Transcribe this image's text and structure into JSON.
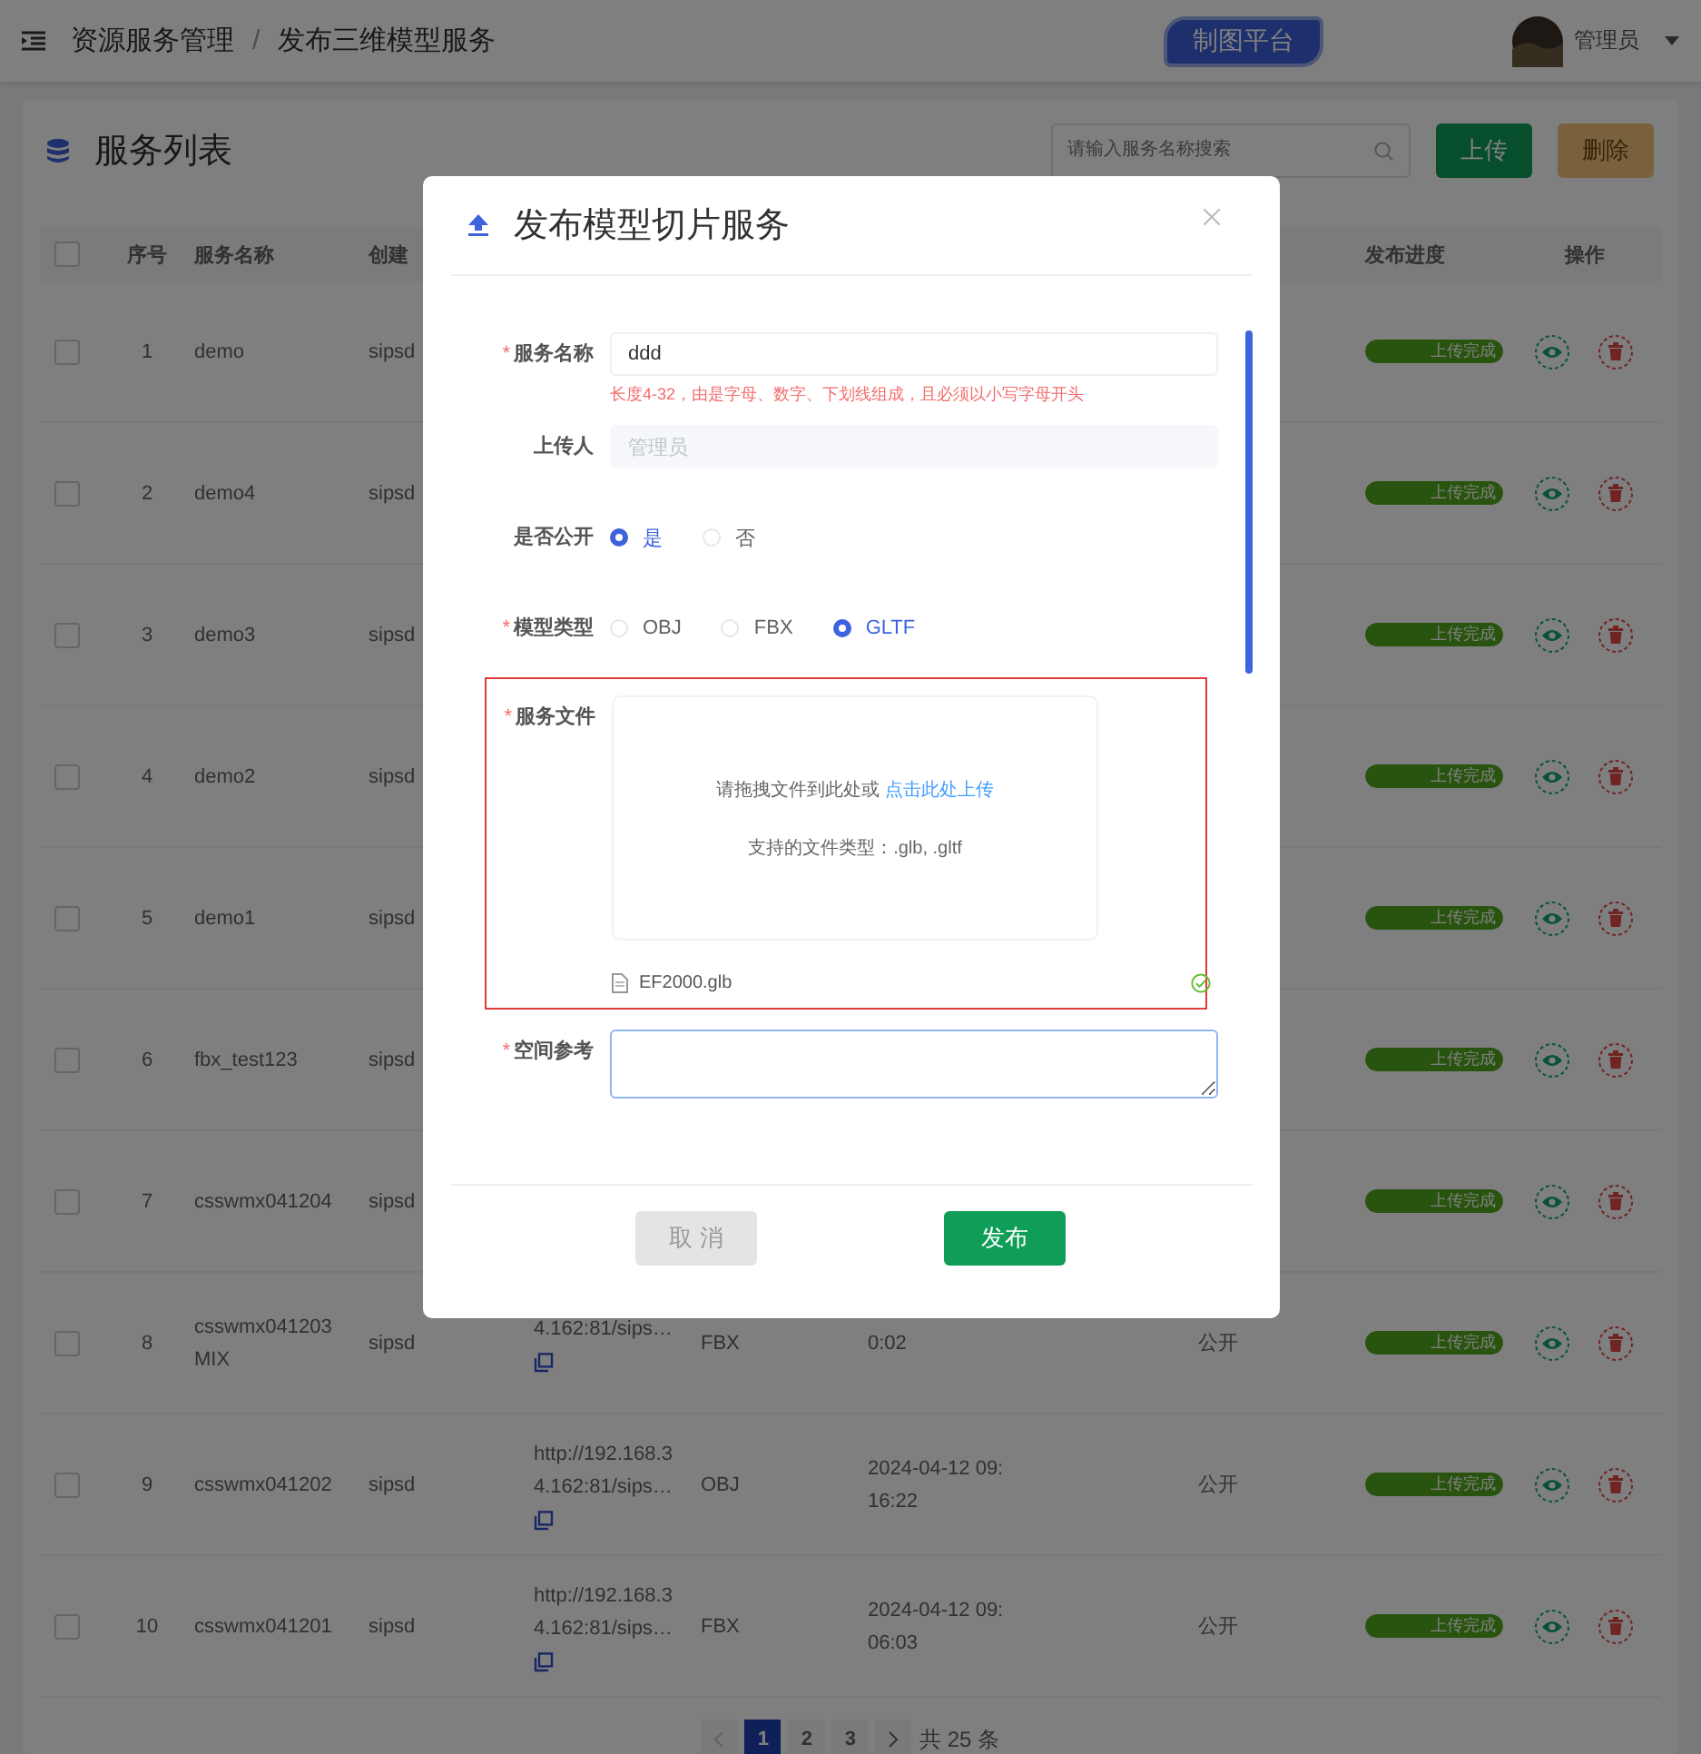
{
  "header": {
    "breadcrumb": [
      "资源服务管理",
      "发布三维模型服务"
    ],
    "separator": "/",
    "platform_badge": "制图平台",
    "user": "管理员"
  },
  "card": {
    "title": "服务列表",
    "search": {
      "placeholder": "请输入服务名称搜索"
    },
    "buttons": [
      {
        "label": "上传",
        "kind": "primary",
        "disabled": false
      },
      {
        "label": "删除",
        "kind": "danger",
        "disabled": true
      }
    ]
  },
  "table": {
    "all_checked": false,
    "columns": {
      "index": "序号",
      "name": "服务名称",
      "creator": "创建",
      "progress": "发布进度",
      "actions": "操作"
    },
    "rows": [
      {
        "checked": false,
        "index": "1",
        "name": "demo",
        "creator": "sipsd",
        "status": "上传完成",
        "level": 1
      },
      {
        "checked": false,
        "index": "2",
        "name": "demo4",
        "creator": "sipsd",
        "status": "上传完成",
        "level": 1
      },
      {
        "checked": false,
        "index": "3",
        "name": "demo3",
        "creator": "sipsd",
        "status": "上传完成",
        "level": 1
      },
      {
        "checked": false,
        "index": "4",
        "name": "demo2",
        "creator": "sipsd",
        "status": "上传完成",
        "level": 1
      },
      {
        "checked": false,
        "index": "5",
        "name": "demo1",
        "creator": "sipsd",
        "status": "上传完成",
        "level": 1
      },
      {
        "checked": false,
        "index": "6",
        "name": "fbx_test123",
        "creator": "sipsd",
        "status": "上传完成",
        "level": 1
      },
      {
        "checked": false,
        "index": "7",
        "name": "csswmx041204",
        "creator": "sipsd",
        "status": "上传完成",
        "level": 1
      },
      {
        "checked": false,
        "index": "8",
        "name": "csswmx041203MIX",
        "creator": "sipsd",
        "url": "4.162:81/sips…",
        "type": "FBX",
        "time": "0:02",
        "visibility": "公开",
        "status": "上传完成",
        "level": 1
      },
      {
        "checked": false,
        "index": "9",
        "name": "csswmx041202",
        "creator": "sipsd",
        "url": "http://192.168.34.162:81/sips…",
        "type": "OBJ",
        "time": "2024-04-12 09:16:22",
        "visibility": "公开",
        "status": "上传完成",
        "level": 1
      },
      {
        "checked": false,
        "index": "10",
        "name": "csswmx041201",
        "creator": "sipsd",
        "url": "http://192.168.34.162:81/sips…",
        "type": "FBX",
        "time": "2024-04-12 09:06:03",
        "visibility": "公开",
        "status": "上传完成",
        "level": 1
      }
    ]
  },
  "pagination": {
    "pages": [
      {
        "label": "1",
        "selected": true
      },
      {
        "label": "2",
        "selected": false
      },
      {
        "label": "3",
        "selected": false
      }
    ],
    "total": "共 25 条"
  },
  "dialog": {
    "title": "发布模型切片服务",
    "required_mark": "*",
    "fields": [
      {
        "kind": "input",
        "label": "服务名称",
        "required": true,
        "value": "ddd",
        "disabled": false,
        "error": "长度4-32，由是字母、数字、下划线组成，且必须以小写字母开头"
      },
      {
        "kind": "input",
        "label": "上传人",
        "required": false,
        "value": "管理员",
        "disabled": true
      },
      {
        "kind": "radio",
        "label": "是否公开",
        "required": false,
        "options": [
          {
            "label": "是",
            "selected": true
          },
          {
            "label": "否",
            "selected": false
          }
        ]
      },
      {
        "kind": "radio",
        "label": "模型类型",
        "required": true,
        "options": [
          {
            "label": "OBJ",
            "selected": false
          },
          {
            "label": "FBX",
            "selected": false
          },
          {
            "label": "GLTF",
            "selected": true
          }
        ]
      },
      {
        "kind": "upload",
        "label": "服务文件",
        "required": true,
        "highlighted": true,
        "hint": "请拖拽文件到此处或",
        "link": "点击此处上传",
        "types": "支持的文件类型：.glb, .gltf",
        "files": [
          {
            "name": "EF2000.glb",
            "done": true
          }
        ]
      },
      {
        "kind": "textarea",
        "label": "空间参考",
        "required": true,
        "focused": true
      }
    ],
    "buttons": [
      {
        "label": "取 消",
        "kind": "cancel"
      },
      {
        "label": "发布",
        "kind": "primary"
      }
    ]
  }
}
